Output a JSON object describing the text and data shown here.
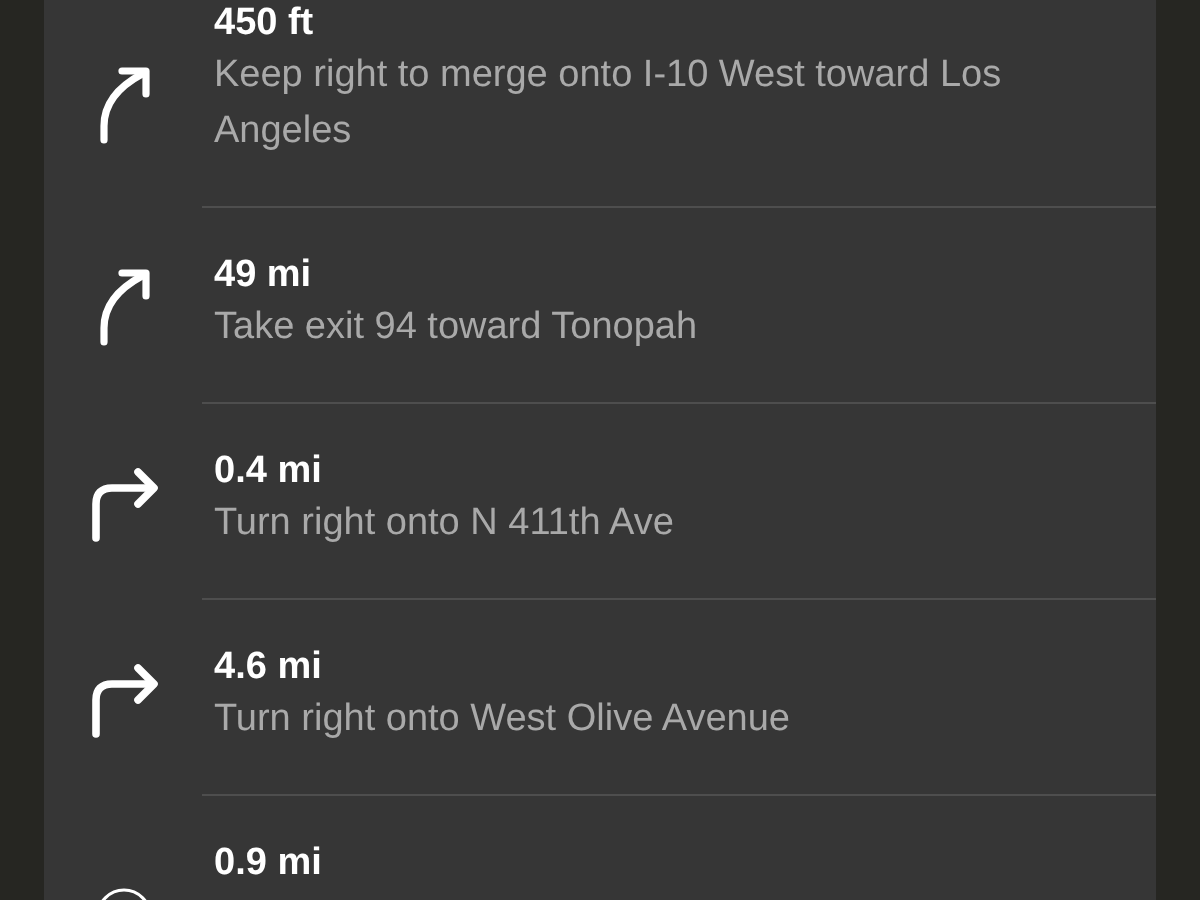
{
  "steps": [
    {
      "kind": "keep-right",
      "distance": "450 ft",
      "instruction": "Keep right to merge onto I-10 West toward Los Angeles"
    },
    {
      "kind": "keep-right",
      "distance": "49 mi",
      "instruction": "Take exit 94 toward Tonopah"
    },
    {
      "kind": "turn-right",
      "distance": "0.4 mi",
      "instruction": "Turn right onto N 411th Ave"
    },
    {
      "kind": "turn-right",
      "distance": "4.6 mi",
      "instruction": "Turn right onto West Olive Avenue"
    },
    {
      "kind": "circle",
      "distance": "0.9 mi"
    }
  ]
}
